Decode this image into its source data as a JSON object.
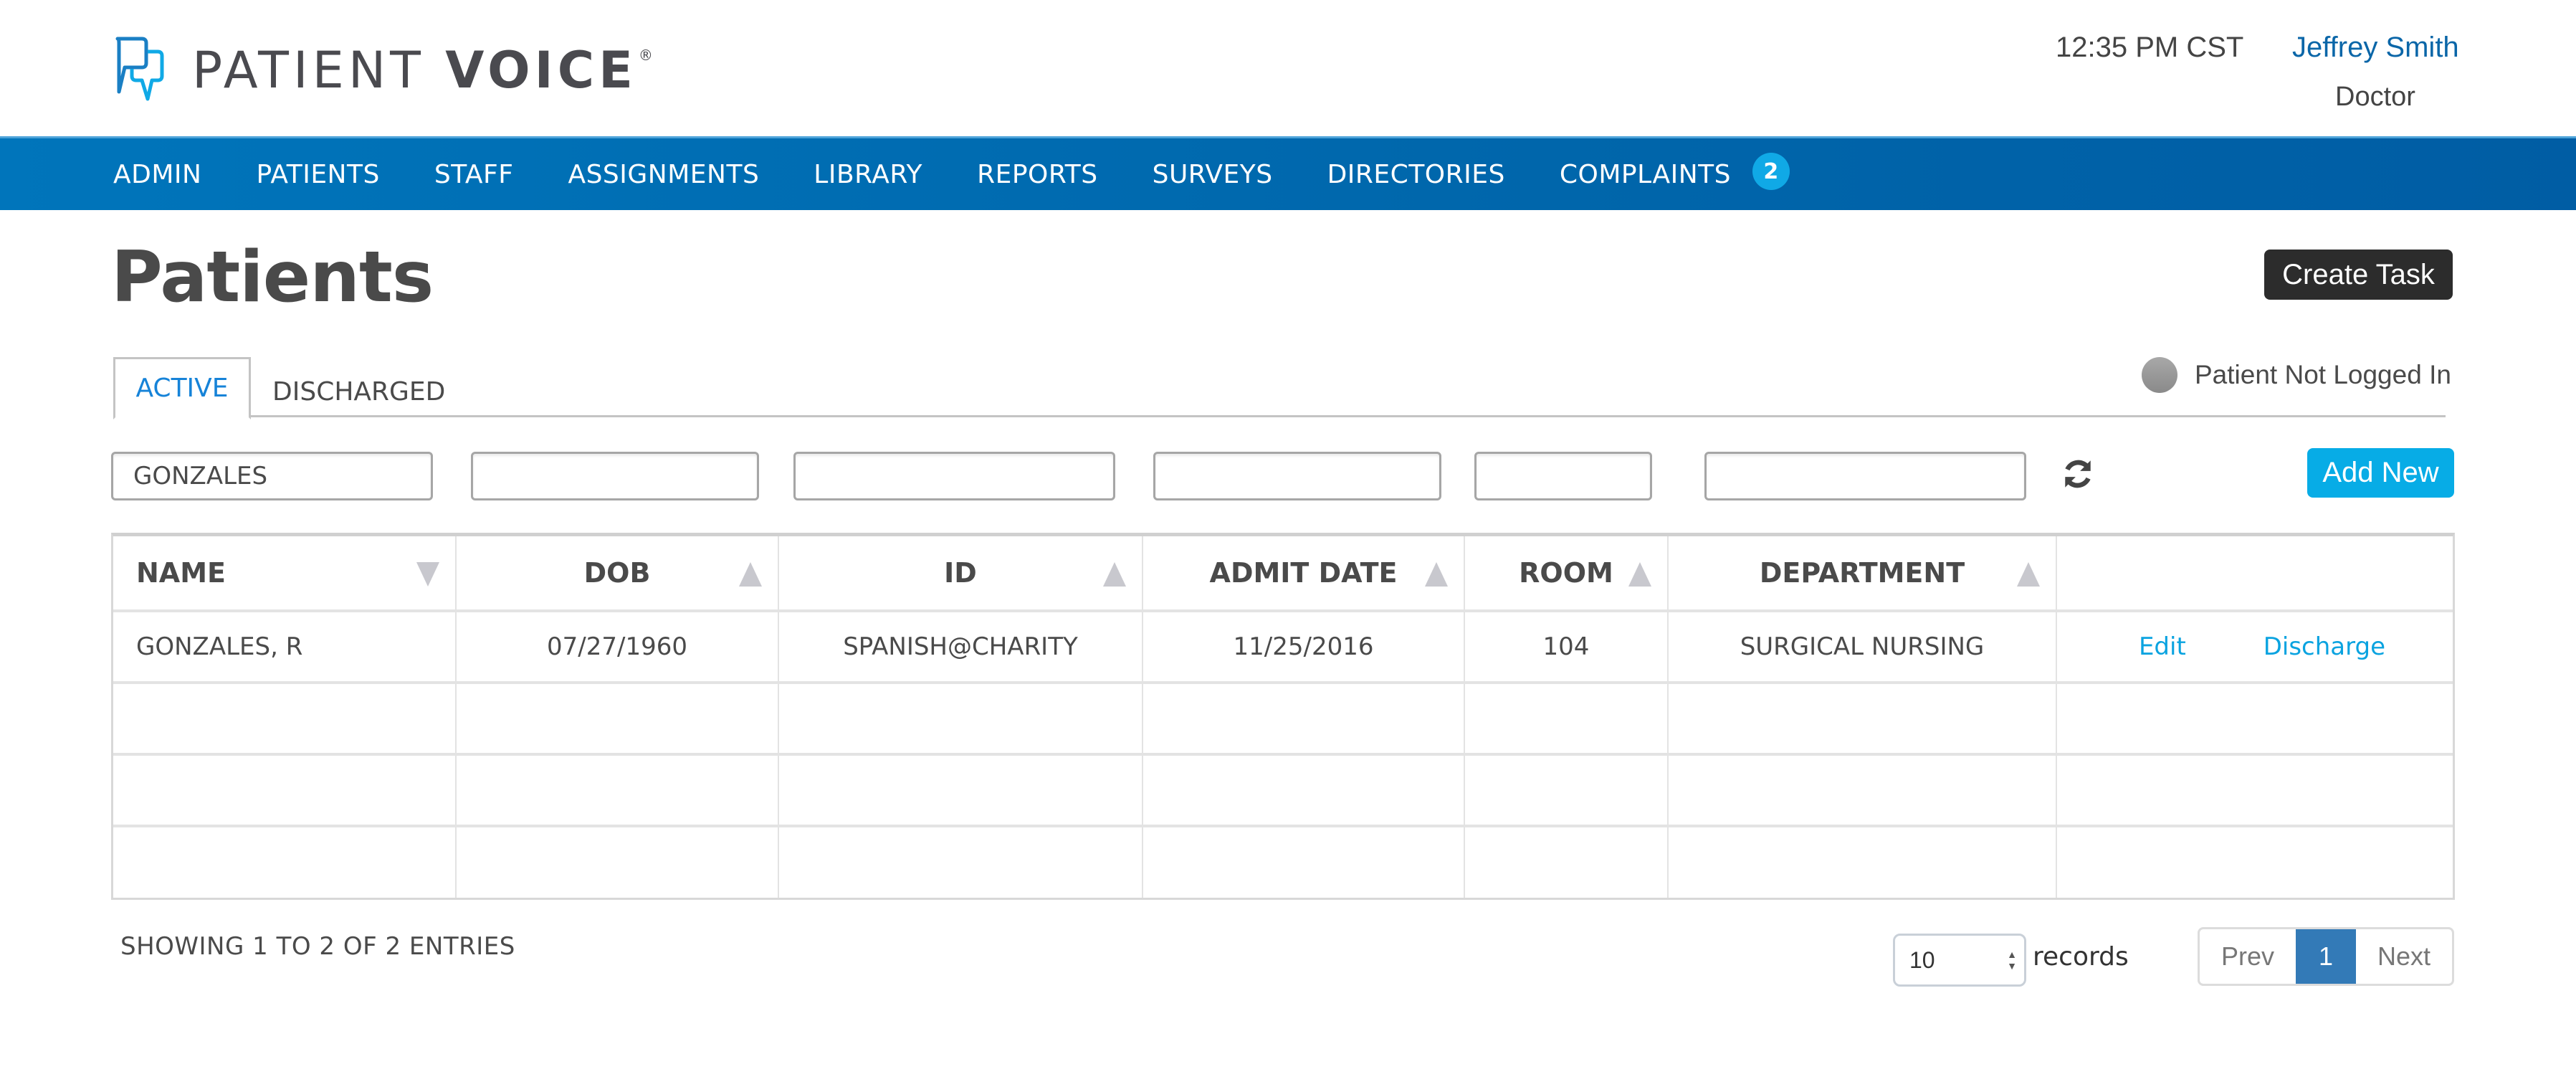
{
  "header": {
    "logo_text_light": "PATIENT ",
    "logo_text_bold": "VOICE",
    "logo_reg": "®",
    "clock": "12:35 PM CST",
    "user_name": "Jeffrey Smith",
    "user_role": "Doctor"
  },
  "nav": {
    "items": [
      {
        "label": "ADMIN"
      },
      {
        "label": "PATIENTS"
      },
      {
        "label": "STAFF"
      },
      {
        "label": "ASSIGNMENTS"
      },
      {
        "label": "LIBRARY"
      },
      {
        "label": "REPORTS"
      },
      {
        "label": "SURVEYS"
      },
      {
        "label": "DIRECTORIES"
      },
      {
        "label": "COMPLAINTS",
        "badge": "2"
      }
    ]
  },
  "page": {
    "title": "Patients",
    "create_task_label": "Create Task",
    "add_new_label": "Add New"
  },
  "tabs": [
    {
      "label": "ACTIVE",
      "active": true
    },
    {
      "label": "DISCHARGED",
      "active": false
    }
  ],
  "login_status": {
    "label": "Patient Not Logged In",
    "color": "#999999"
  },
  "filters": [
    {
      "field": "name",
      "value": "GONZALES"
    },
    {
      "field": "dob",
      "value": ""
    },
    {
      "field": "id",
      "value": ""
    },
    {
      "field": "admit_date",
      "value": ""
    },
    {
      "field": "room",
      "value": ""
    },
    {
      "field": "department",
      "value": ""
    }
  ],
  "table": {
    "columns": [
      {
        "label": "NAME",
        "sort": "desc"
      },
      {
        "label": "DOB",
        "sort": "asc"
      },
      {
        "label": "ID",
        "sort": "asc"
      },
      {
        "label": "ADMIT DATE",
        "sort": "asc"
      },
      {
        "label": "ROOM",
        "sort": "asc"
      },
      {
        "label": "DEPARTMENT",
        "sort": "asc"
      },
      {
        "label": "",
        "sort": ""
      }
    ],
    "rows": [
      {
        "name": "GONZALES, R",
        "dob": "07/27/1960",
        "id": "SPANISH@CHARITY",
        "admit_date": "11/25/2016",
        "room": "104",
        "department": "SURGICAL NURSING",
        "edit_label": "Edit",
        "discharge_label": "Discharge"
      },
      {
        "name": "",
        "dob": "",
        "id": "",
        "admit_date": "",
        "room": "",
        "department": "",
        "edit_label": "",
        "discharge_label": ""
      },
      {
        "name": "",
        "dob": "",
        "id": "",
        "admit_date": "",
        "room": "",
        "department": "",
        "edit_label": "",
        "discharge_label": ""
      },
      {
        "name": "",
        "dob": "",
        "id": "",
        "admit_date": "",
        "room": "",
        "department": "",
        "edit_label": "",
        "discharge_label": ""
      }
    ]
  },
  "footer": {
    "showing": "SHOWING 1 TO 2 OF 2 ENTRIES",
    "page_size": "10",
    "records_label": "records",
    "prev_label": "Prev",
    "current_page": "1",
    "next_label": "Next"
  },
  "colors": {
    "brand_blue": "#0075bb",
    "accent_cyan": "#07ace6",
    "link": "#0aa3e0",
    "user_link": "#0a66a8",
    "pager_active": "#337ab7",
    "dark_button": "#2c2c2c"
  }
}
